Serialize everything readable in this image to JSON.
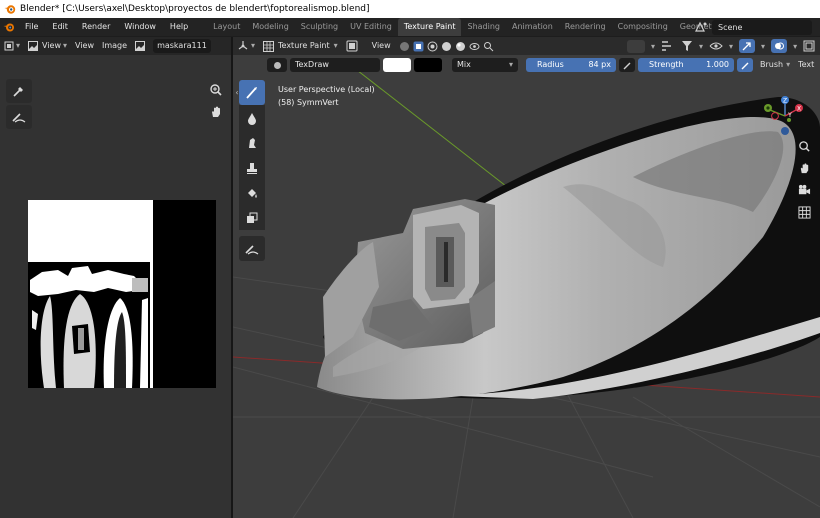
{
  "window": {
    "title": "Blender* [C:\\Users\\axel\\Desktop\\proyectos de blendert\\foptorealismop.blend]"
  },
  "menu": {
    "items": [
      "File",
      "Edit",
      "Render",
      "Window",
      "Help"
    ],
    "workspaces": [
      "Layout",
      "Modeling",
      "Sculpting",
      "UV Editing",
      "Texture Paint",
      "Shading",
      "Animation",
      "Rendering",
      "Compositing",
      "Geometry N"
    ],
    "active_workspace": "Texture Paint",
    "scene": "Scene"
  },
  "image_editor": {
    "view_label": "View",
    "view2_label": "View",
    "image_label": "Image",
    "image_name": "maskara111"
  },
  "viewport": {
    "mode": "Texture Paint",
    "view_label": "View",
    "overlay_line1": "User Perspective (Local)",
    "overlay_line2": "(58) SymmVert",
    "gizmo": {
      "z": "Z",
      "x": "X",
      "y": "Y"
    }
  },
  "tool_settings": {
    "brush_name": "TexDraw",
    "color": "#ffffff",
    "secondary_color": "#000000",
    "blend_mode": "Mix",
    "radius_label": "Radius",
    "radius_value": "84 px",
    "strength_label": "Strength",
    "strength_value": "1.000",
    "brush_menu": "Brush",
    "texture_menu": "Text"
  },
  "colors": {
    "accent": "#4772b3",
    "header": "#2b2b2b",
    "viewport_bg": "#3d3d3d"
  }
}
